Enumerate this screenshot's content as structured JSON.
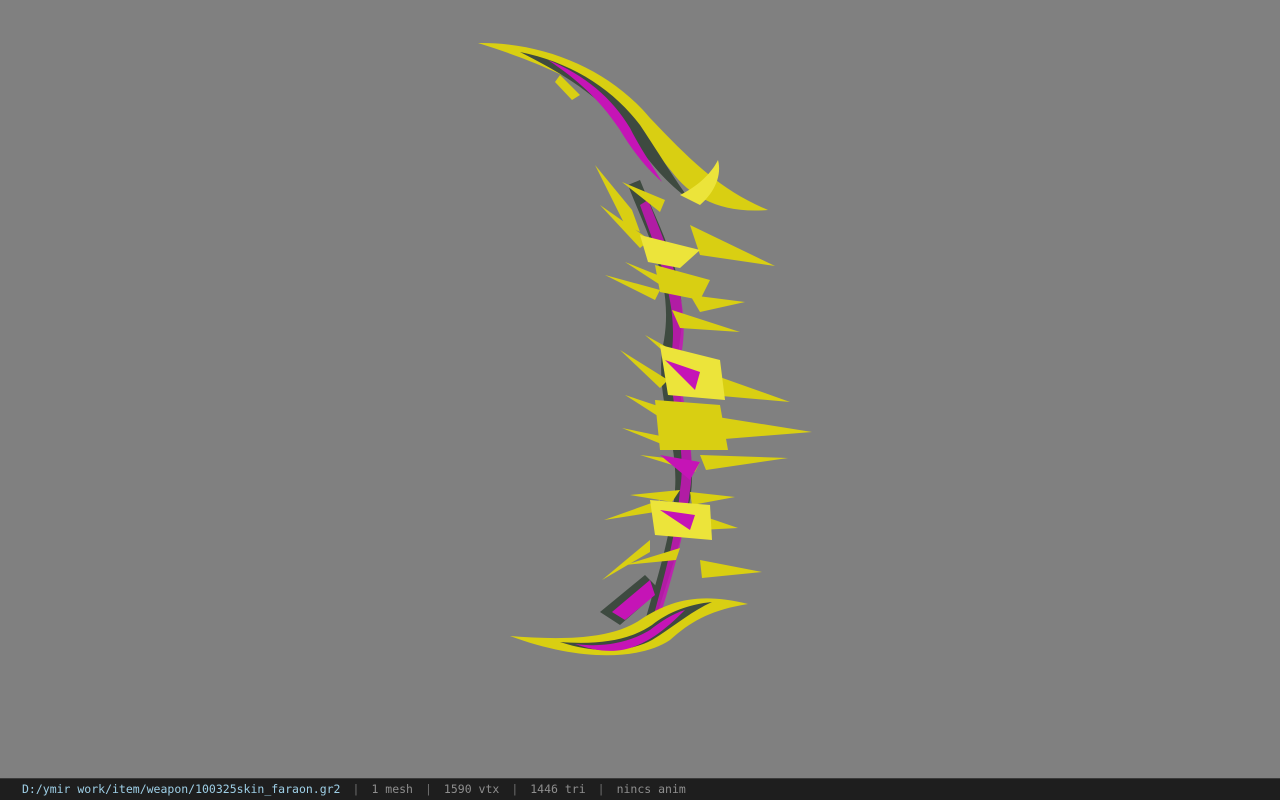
{
  "viewer": {
    "background_color": "#808080",
    "model": {
      "colors": {
        "gold": "#d9cf12",
        "gold_light": "#ece43a",
        "dark": "#3e4a40",
        "magenta": "#c514b6"
      }
    }
  },
  "statusbar": {
    "file_path": "D:/ymir work/item/weapon/100325skin_faraon.gr2",
    "separator": "|",
    "mesh_count": "1 mesh",
    "vertex_count": "1590 vtx",
    "triangle_count": "1446 tri",
    "anim_status": "nincs anim"
  }
}
